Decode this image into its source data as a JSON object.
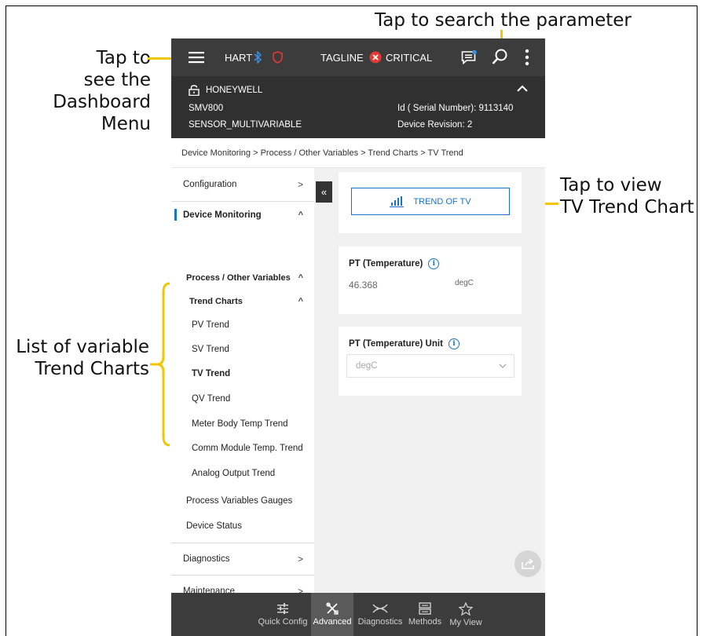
{
  "callouts": {
    "search": "Tap to search the parameter",
    "dashboard": [
      "Tap to",
      "see the",
      "Dashboard",
      "Menu"
    ],
    "trend_chart": [
      "Tap to view",
      "TV Trend Chart"
    ],
    "variable_list": [
      "List of variable",
      "Trend Charts"
    ]
  },
  "topbar": {
    "protocol": "HART",
    "tagline": "TAGLINE",
    "status": "CRITICAL"
  },
  "device": {
    "manufacturer": "HONEYWELL",
    "model": "SMV800",
    "sensor": "SENSOR_MULTIVARIABLE",
    "serial": "Id ( Serial Number): 9113140",
    "revision": "Device Revision: 2"
  },
  "breadcrumb": "Device Monitoring > Process / Other Variables > Trend Charts > TV Trend",
  "sidebar": {
    "configuration": "Configuration",
    "device_monitoring": "Device Monitoring",
    "process_other": "Process / Other Variables",
    "trend_charts": "Trend Charts",
    "trends": [
      "PV Trend",
      "SV Trend",
      "TV Trend",
      "QV Trend",
      "Meter Body Temp Trend",
      "Comm Module Temp. Trend",
      "Analog Output Trend"
    ],
    "gauges": "Process Variables Gauges",
    "device_status": "Device Status",
    "diagnostics": "Diagnostics",
    "maintenance": "Maintenance"
  },
  "main": {
    "trend_button": "TREND OF TV",
    "pt_label": "PT (Temperature)",
    "pt_value": "46.368",
    "pt_unit": "degC",
    "pt_unit_label": "PT (Temperature) Unit",
    "pt_unit_select": "degC"
  },
  "bottom_tabs": [
    "Quick Config",
    "Advanced",
    "Diagnostics",
    "Methods",
    "My View"
  ],
  "colors": {
    "accent": "#1a73c7",
    "callout_line": "#f2c700",
    "critical": "#e53935",
    "appbar": "#3c3c3c"
  }
}
